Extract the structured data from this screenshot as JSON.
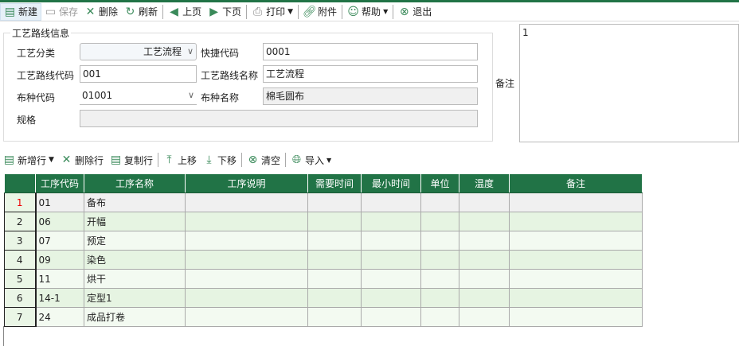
{
  "toolbar": {
    "new": "新建",
    "save": "保存",
    "delete": "删除",
    "refresh": "刷新",
    "prev": "上页",
    "next": "下页",
    "print": "打印",
    "attach": "附件",
    "help": "帮助",
    "exit": "退出"
  },
  "form": {
    "legend": "工艺路线信息",
    "category_label": "工艺分类",
    "category_value": "工艺流程",
    "shortcode_label": "快捷代码",
    "shortcode_value": "0001",
    "route_code_label": "工艺路线代码",
    "route_code_value": "001",
    "route_name_label": "工艺路线名称",
    "route_name_value": "工艺流程",
    "fabric_code_label": "布种代码",
    "fabric_code_value": "01001",
    "fabric_name_label": "布种名称",
    "fabric_name_value": "棉毛圆布",
    "spec_label": "规格",
    "spec_value": "",
    "remark_label": "备注",
    "remark_value": "1"
  },
  "grid_toolbar": {
    "add_row": "新增行",
    "delete_row": "删除行",
    "copy_row": "复制行",
    "move_up": "上移",
    "move_down": "下移",
    "clear": "清空",
    "import": "导入"
  },
  "grid": {
    "columns": [
      "",
      "工序代码",
      "工序名称",
      "工序说明",
      "需要时间",
      "最小时间",
      "单位",
      "温度",
      "备注"
    ],
    "rows": [
      {
        "n": "1",
        "code": "01",
        "name": "备布"
      },
      {
        "n": "2",
        "code": "06",
        "name": "开幅"
      },
      {
        "n": "3",
        "code": "07",
        "name": "预定"
      },
      {
        "n": "4",
        "code": "09",
        "name": "染色"
      },
      {
        "n": "5",
        "code": "11",
        "name": "烘干"
      },
      {
        "n": "6",
        "code": "14-1",
        "name": "定型1"
      },
      {
        "n": "7",
        "code": "24",
        "name": "成品打卷"
      }
    ]
  },
  "colors": {
    "accent": "#217346",
    "selected_row_num": "#e00000"
  }
}
